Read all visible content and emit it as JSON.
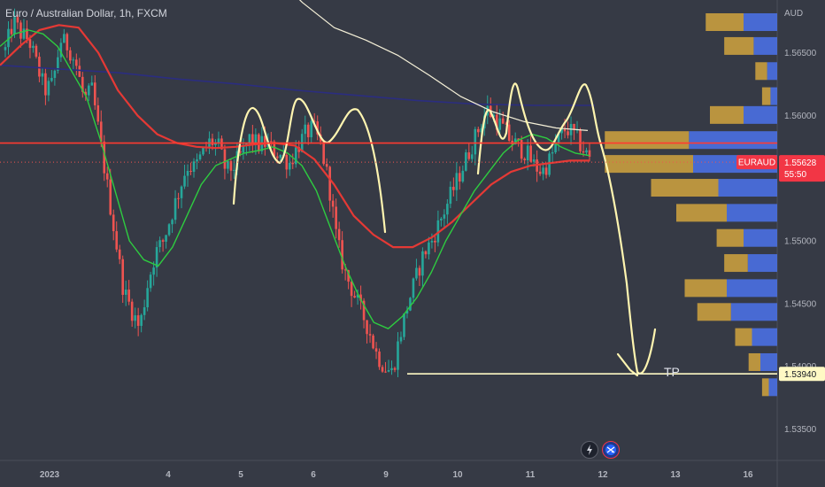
{
  "header": {
    "title": "Euro / Australian Dollar, 1h, FXCM"
  },
  "chart_data": {
    "type": "candlestick",
    "title": "Euro / Australian Dollar, 1h, FXCM",
    "currency": "AUD",
    "ylim": [
      1.5325,
      1.5692
    ],
    "y_ticks": [
      "1.56500",
      "1.56000",
      "1.55500",
      "1.55000",
      "1.54500",
      "1.54000",
      "1.53500"
    ],
    "x_ticks": [
      "2023",
      "4",
      "5",
      "6",
      "9",
      "10",
      "11",
      "12",
      "13",
      "16"
    ],
    "last_price": {
      "symbol": "EURAUD",
      "value": "1.55628",
      "countdown": "55:50",
      "price": 1.55628
    },
    "target": {
      "label": "TP",
      "value": "1.53940",
      "price": 1.5394
    },
    "horizontal_line_price": 1.5578,
    "colors": {
      "background": "#363a45",
      "up_candle": "#26a69a",
      "down_candle": "#ef5350",
      "ema_fast": "#2ecc40",
      "ema_slow": "#e53935",
      "sma_long": "#f5f0d8",
      "sma_blue": "#2b2d80",
      "drawing": "#fff5b0",
      "vp_up": "#4a6fe0",
      "vp_down": "#d1a53e",
      "price_label": "#f23645",
      "tp_label": "#fff9c4"
    },
    "close_path": [
      1.5652,
      1.5675,
      1.5665,
      1.566,
      1.564,
      1.562,
      1.5625,
      1.566,
      1.5655,
      1.564,
      1.5612,
      1.562,
      1.558,
      1.554,
      1.55,
      1.546,
      1.5445,
      1.543,
      1.5465,
      1.549,
      1.55,
      1.552,
      1.554,
      1.556,
      1.5558,
      1.557,
      1.558,
      1.5575,
      1.5555,
      1.556,
      1.557,
      1.5582,
      1.5576,
      1.5578,
      1.5572,
      1.5568,
      1.5562,
      1.5575,
      1.5585,
      1.559,
      1.5575,
      1.5545,
      1.55,
      1.5475,
      1.546,
      1.5445,
      1.543,
      1.541,
      1.54,
      1.5395,
      1.5425,
      1.545,
      1.547,
      1.549,
      1.55,
      1.5515,
      1.553,
      1.5545,
      1.556,
      1.5575,
      1.559,
      1.5605,
      1.5598,
      1.559,
      1.558,
      1.5575,
      1.557,
      1.556,
      1.5555,
      1.5565,
      1.558,
      1.559,
      1.5585,
      1.5575,
      1.5565
    ],
    "ema_fast": [
      1.5655,
      1.5665,
      1.5668,
      1.5665,
      1.5655,
      1.5635,
      1.5615,
      1.558,
      1.554,
      1.55,
      1.5485,
      1.548,
      1.5495,
      1.552,
      1.5545,
      1.556,
      1.5565,
      1.557,
      1.5572,
      1.5575,
      1.557,
      1.556,
      1.554,
      1.551,
      1.548,
      1.5455,
      1.5435,
      1.543,
      1.544,
      1.5455,
      1.5475,
      1.55,
      1.552,
      1.554,
      1.5555,
      1.557,
      1.558,
      1.5585,
      1.5582,
      1.5575,
      1.557,
      1.5568
    ],
    "ema_slow": [
      1.564,
      1.5655,
      1.5668,
      1.5672,
      1.567,
      1.565,
      1.562,
      1.56,
      1.5585,
      1.5578,
      1.5575,
      1.5574,
      1.5575,
      1.5577,
      1.5578,
      1.5576,
      1.5565,
      1.5545,
      1.552,
      1.5505,
      1.5495,
      1.5495,
      1.5503,
      1.5515,
      1.553,
      1.5545,
      1.5555,
      1.556,
      1.5562,
      1.5564,
      1.5564
    ],
    "sma_long": [
      1.574,
      1.5715,
      1.569,
      1.567,
      1.566,
      1.5648,
      1.5632,
      1.5615,
      1.5603,
      1.5595,
      1.559,
      1.5588
    ],
    "sma_blue": [
      1.564,
      1.5637,
      1.5634,
      1.5629,
      1.5625,
      1.562,
      1.5616,
      1.5612,
      1.5609,
      1.5608,
      1.5608
    ],
    "volume_profile": [
      {
        "price": 1.5674,
        "up": 40,
        "down": 45
      },
      {
        "price": 1.5655,
        "up": 28,
        "down": 35
      },
      {
        "price": 1.5635,
        "up": 12,
        "down": 14
      },
      {
        "price": 1.5615,
        "up": 8,
        "down": 10
      },
      {
        "price": 1.56,
        "up": 40,
        "down": 40
      },
      {
        "price": 1.558,
        "up": 105,
        "down": 100
      },
      {
        "price": 1.5561,
        "up": 100,
        "down": 105
      },
      {
        "price": 1.5542,
        "up": 70,
        "down": 80
      },
      {
        "price": 1.5522,
        "up": 60,
        "down": 60
      },
      {
        "price": 1.5502,
        "up": 40,
        "down": 32
      },
      {
        "price": 1.5482,
        "up": 35,
        "down": 28
      },
      {
        "price": 1.5462,
        "up": 60,
        "down": 50
      },
      {
        "price": 1.5443,
        "up": 55,
        "down": 40
      },
      {
        "price": 1.5423,
        "up": 30,
        "down": 20
      },
      {
        "price": 1.5403,
        "up": 20,
        "down": 14
      },
      {
        "price": 1.5383,
        "up": 10,
        "down": 8
      }
    ]
  }
}
